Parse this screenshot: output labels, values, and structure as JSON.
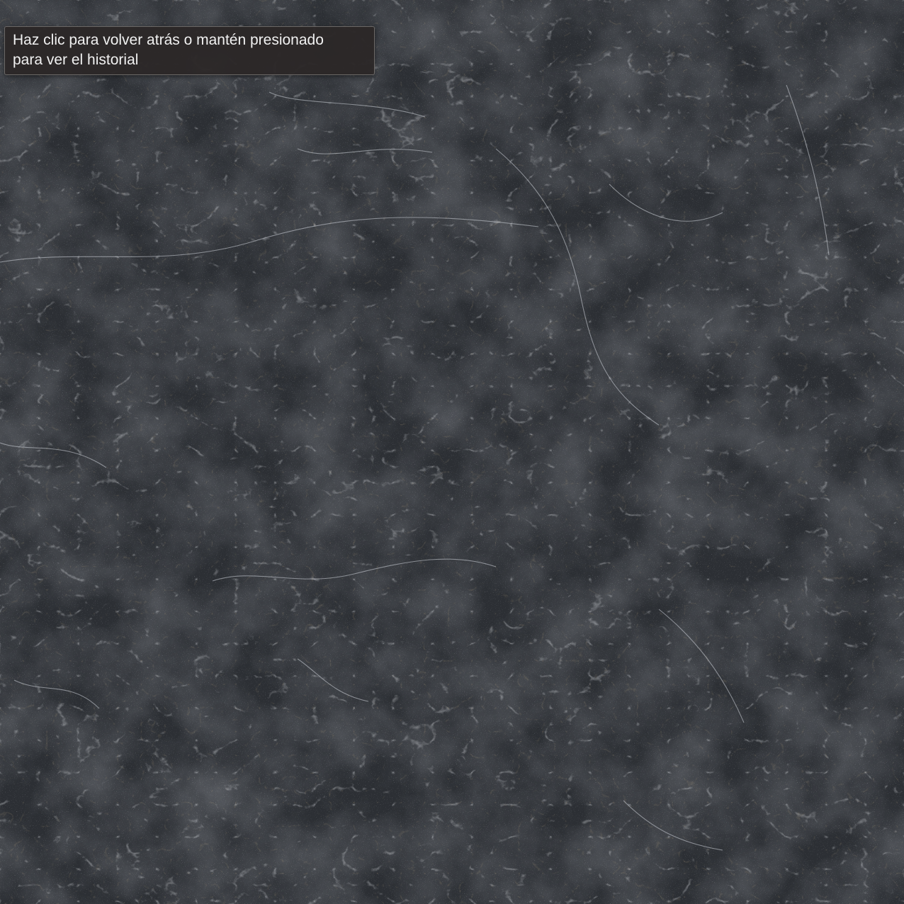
{
  "tooltip": {
    "lines": [
      "Haz clic para volver atrás o mantén presionado",
      "para ver el historial"
    ]
  },
  "background": {
    "base_color": "#2b2e33",
    "vein_color": "#d9dde2",
    "mineral_color": "#8a6a3c"
  }
}
